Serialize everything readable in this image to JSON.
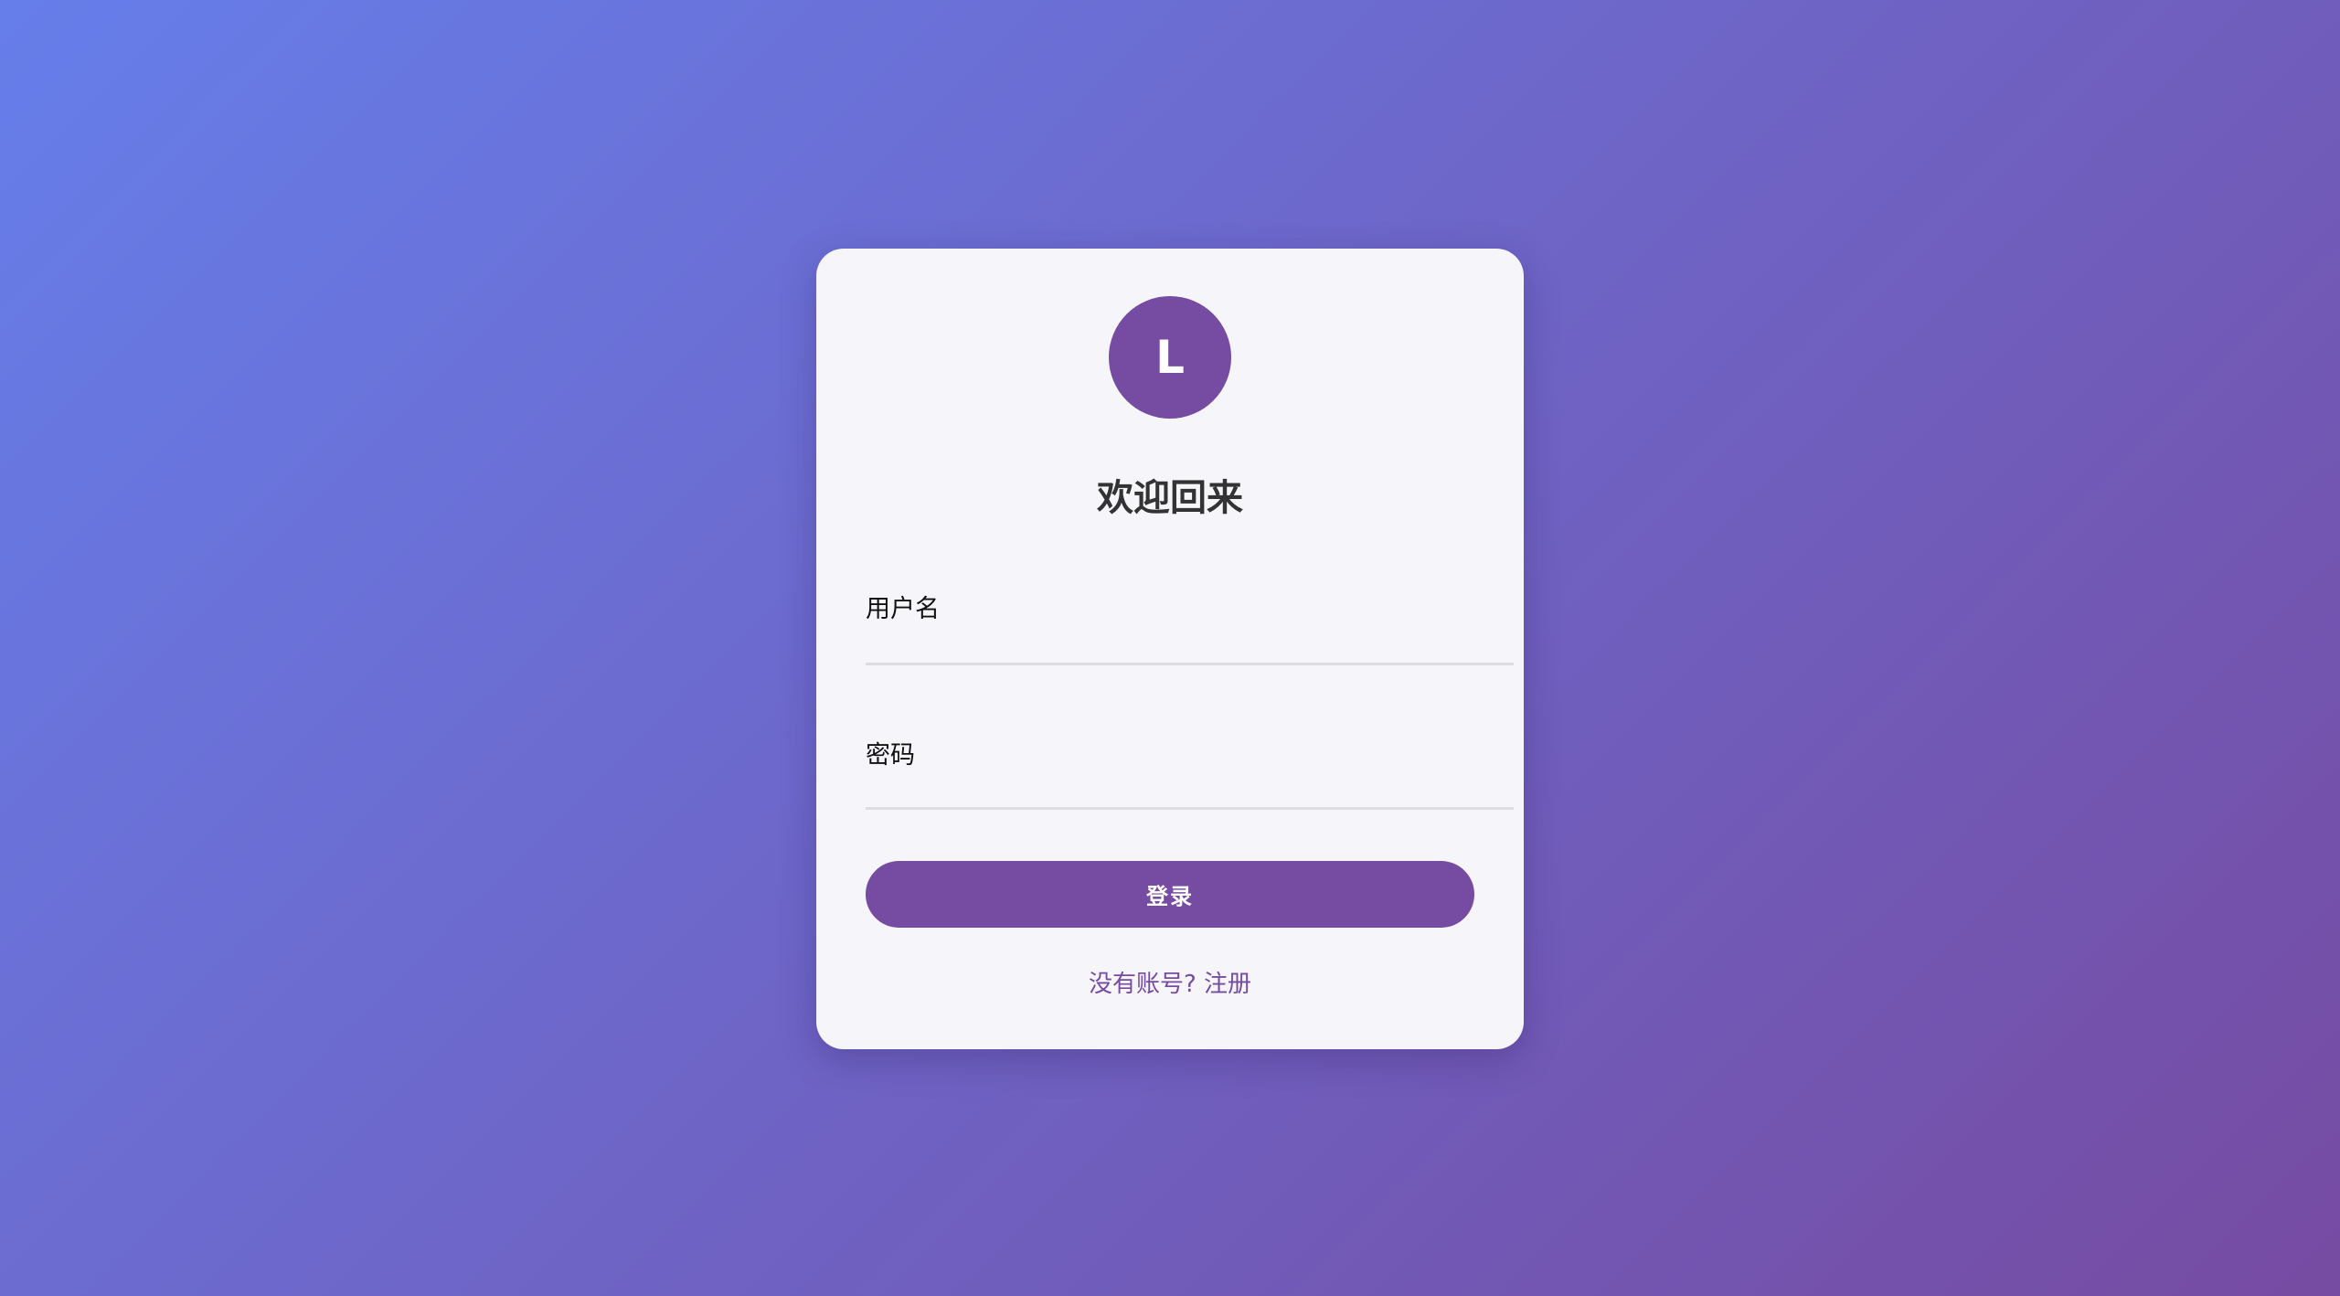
{
  "avatar": {
    "letter": "L"
  },
  "title": "欢迎回来",
  "form": {
    "username_label": "用户名",
    "username_value": "",
    "password_label": "密码",
    "password_value": "",
    "login_label": "登录"
  },
  "footer": {
    "prompt": "没有账号? ",
    "register_link": "注册"
  },
  "colors": {
    "gradient_start": "#667eea",
    "gradient_end": "#764ba2",
    "accent": "#764ba2"
  }
}
